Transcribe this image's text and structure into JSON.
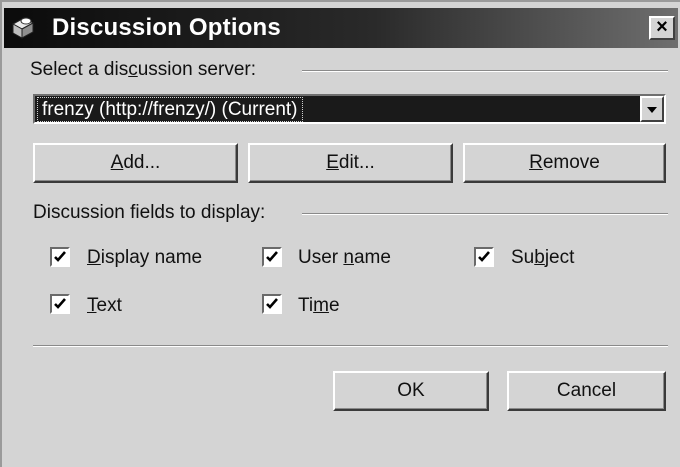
{
  "window": {
    "title": "Discussion Options",
    "close_glyph": "×"
  },
  "server_group": {
    "label_pre": "Select a dis",
    "label_mnemonic": "c",
    "label_post": "ussion server:",
    "selected_server": "frenzy (http://frenzy/) (Current)"
  },
  "buttons": {
    "add": {
      "mnemonic": "A",
      "rest": "dd..."
    },
    "edit": {
      "mnemonic": "E",
      "rest": "dit..."
    },
    "remove": {
      "mnemonic": "R",
      "rest": "emove"
    },
    "ok": "OK",
    "cancel": "Cancel"
  },
  "fields_group": {
    "label": "Discussion fields to display:",
    "fields": [
      {
        "pre": "",
        "mnemonic": "D",
        "post": "isplay name",
        "checked": true
      },
      {
        "pre": "User ",
        "mnemonic": "n",
        "post": "ame",
        "checked": true
      },
      {
        "pre": "Su",
        "mnemonic": "b",
        "post": "ject",
        "checked": true
      },
      {
        "pre": "",
        "mnemonic": "T",
        "post": "ext",
        "checked": true
      },
      {
        "pre": "Ti",
        "mnemonic": "m",
        "post": "e",
        "checked": true
      }
    ]
  },
  "icons": {
    "title": "discussion-icon",
    "dropdown": "chevron-down-icon",
    "check": "checkmark-icon"
  }
}
